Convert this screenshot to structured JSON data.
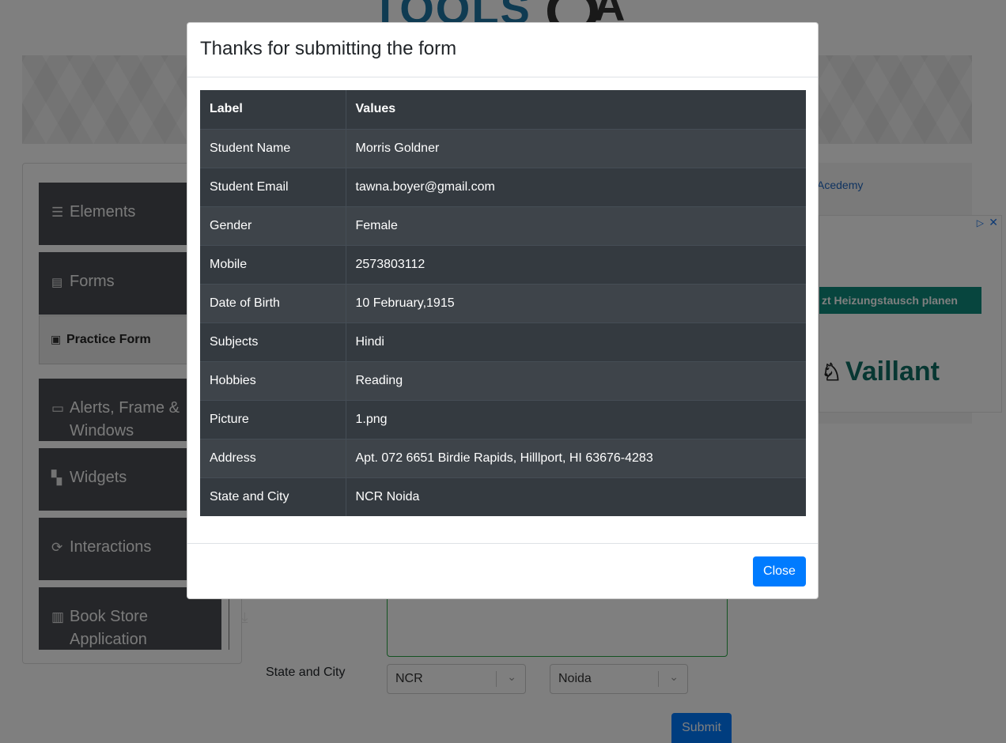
{
  "logo": {
    "text": "TOOLS",
    "suffix": "A"
  },
  "sidebar": {
    "groups": [
      {
        "label": "Elements",
        "icon": "hamburger-icon"
      },
      {
        "label": "Forms",
        "icon": "document-icon"
      },
      {
        "label": "Alerts, Frame & Windows",
        "icon": "window-icon"
      },
      {
        "label": "Widgets",
        "icon": "widgets-icon"
      },
      {
        "label": "Interactions",
        "icon": "interactions-icon"
      },
      {
        "label": "Book Store Application",
        "icon": "books-icon"
      }
    ],
    "active_item": {
      "label": "Practice Form",
      "icon": "form-icon"
    }
  },
  "ad": {
    "link_text": "Acedemy",
    "headline": "zt Heizungstausch planen",
    "brand": "Vaillant"
  },
  "form": {
    "state_city_label": "State and City",
    "state_value": "NCR",
    "city_value": "Noida",
    "submit_label": "Submit"
  },
  "modal": {
    "title": "Thanks for submitting the form",
    "columns": [
      "Label",
      "Values"
    ],
    "rows": [
      {
        "label": "Student Name",
        "value": "Morris Goldner"
      },
      {
        "label": "Student Email",
        "value": "tawna.boyer@gmail.com"
      },
      {
        "label": "Gender",
        "value": "Female"
      },
      {
        "label": "Mobile",
        "value": "2573803112"
      },
      {
        "label": "Date of Birth",
        "value": "10 February,1915"
      },
      {
        "label": "Subjects",
        "value": "Hindi"
      },
      {
        "label": "Hobbies",
        "value": "Reading"
      },
      {
        "label": "Picture",
        "value": "1.png"
      },
      {
        "label": "Address",
        "value": "Apt. 072 6651 Birdie Rapids, Hilllport, HI 63676-4283"
      },
      {
        "label": "State and City",
        "value": "NCR Noida"
      }
    ],
    "close_label": "Close"
  },
  "colors": {
    "primary": "#007bff",
    "table_dark": "#343a40",
    "overlay": "rgba(0,0,0,0.5)"
  }
}
